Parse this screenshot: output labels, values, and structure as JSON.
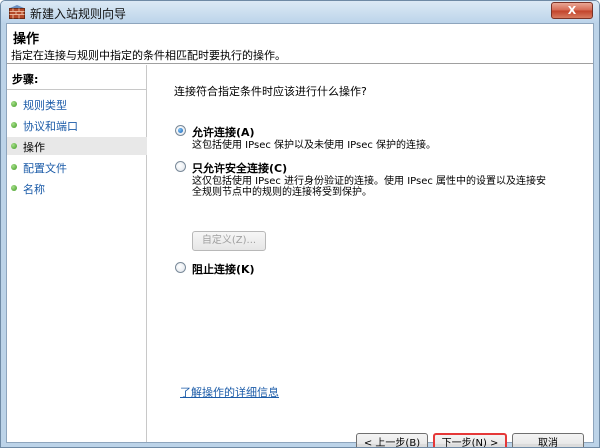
{
  "window": {
    "title": "新建入站规则向导",
    "close_label": "X"
  },
  "header": {
    "title": "操作",
    "description": "指定在连接与规则中指定的条件相匹配时要执行的操作。"
  },
  "sidebar": {
    "steps_label": "步骤:",
    "items": [
      {
        "label": "规则类型",
        "active": false
      },
      {
        "label": "协议和端口",
        "active": false
      },
      {
        "label": "操作",
        "active": true
      },
      {
        "label": "配置文件",
        "active": false
      },
      {
        "label": "名称",
        "active": false
      }
    ]
  },
  "main": {
    "question": "连接符合指定条件时应该进行什么操作?",
    "options": [
      {
        "label": "允许连接(A)",
        "desc_lines": [
          "这包括使用 IPsec 保护以及未使用 IPsec 保护的连接。"
        ],
        "selected": true
      },
      {
        "label": "只允许安全连接(C)",
        "desc_lines": [
          "这仅包括使用 IPsec 进行身份验证的连接。使用 IPsec 属性中的设置以及连接安",
          "全规则节点中的规则的连接将受到保护。"
        ],
        "selected": false
      },
      {
        "label": "阻止连接(K)",
        "desc_lines": [],
        "selected": false
      }
    ],
    "custom_button": "自定义(Z)...",
    "help_link": "了解操作的详细信息"
  },
  "buttons": {
    "back": "< 上一步(B)",
    "next": "下一步(N) >",
    "cancel": "取消"
  }
}
